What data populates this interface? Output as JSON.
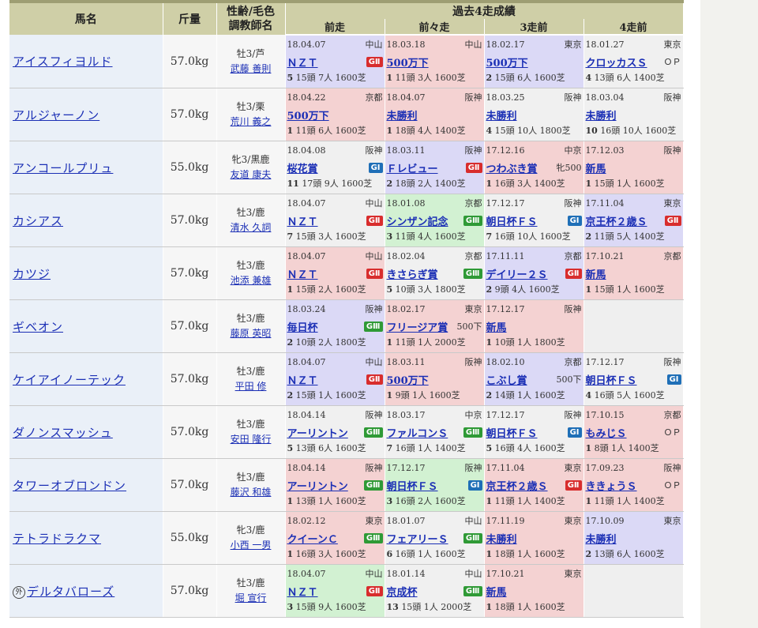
{
  "headers": {
    "name": "馬名",
    "weight": "斤量",
    "sex_line1": "性齢/毛色",
    "sex_line2": "調教師名",
    "past": "過去4走成績",
    "past_cols": [
      "前走",
      "前々走",
      "3走前",
      "4走前"
    ]
  },
  "grade_colors": {
    "GI": "#1f6fb7",
    "GII": "#d82d2d",
    "GIII": "#2f9a36"
  },
  "row_bg_colors": {
    "red": "#f4d2d2",
    "blue": "#dbd9f6",
    "green": "#d2f1d2",
    "gray": "#f0f0f0"
  },
  "horses": [
    {
      "prefix": "",
      "name": "アイスフィヨルド",
      "weight": "57.0kg",
      "sex": "牡3/芦",
      "trainer": "武藤 善則",
      "past": [
        {
          "date": "18.04.07",
          "venue": "中山",
          "race": "ＮＺＴ",
          "grade": "GII",
          "cls": "",
          "result": "5",
          "detail": "15頭 7人 1600芝",
          "bg": "blue"
        },
        {
          "date": "18.03.18",
          "venue": "中山",
          "race": "500万下",
          "grade": "",
          "cls": "",
          "result": "1",
          "detail": "11頭 3人 1600芝",
          "bg": "red"
        },
        {
          "date": "18.02.17",
          "venue": "東京",
          "race": "500万下",
          "grade": "",
          "cls": "",
          "result": "2",
          "detail": "15頭 6人 1600芝",
          "bg": "blue"
        },
        {
          "date": "18.01.27",
          "venue": "東京",
          "race": "クロッカスＳ",
          "grade": "",
          "cls": "ＯＰ",
          "result": "4",
          "detail": "13頭 6人 1400芝",
          "bg": "gray"
        }
      ]
    },
    {
      "prefix": "",
      "name": "アルジャーノン",
      "weight": "57.0kg",
      "sex": "牡3/栗",
      "trainer": "荒川 義之",
      "past": [
        {
          "date": "18.04.22",
          "venue": "京都",
          "race": "500万下",
          "grade": "",
          "cls": "",
          "result": "1",
          "detail": "11頭 6人 1600芝",
          "bg": "red"
        },
        {
          "date": "18.04.07",
          "venue": "阪神",
          "race": "未勝利",
          "grade": "",
          "cls": "",
          "result": "1",
          "detail": "18頭 4人 1400芝",
          "bg": "red"
        },
        {
          "date": "18.03.25",
          "venue": "阪神",
          "race": "未勝利",
          "grade": "",
          "cls": "",
          "result": "4",
          "detail": "15頭 10人 1800芝",
          "bg": "gray"
        },
        {
          "date": "18.03.04",
          "venue": "阪神",
          "race": "未勝利",
          "grade": "",
          "cls": "",
          "result": "10",
          "detail": "16頭 10人 1600芝",
          "bg": "gray"
        }
      ]
    },
    {
      "prefix": "",
      "name": "アンコールプリュ",
      "weight": "55.0kg",
      "sex": "牝3/黒鹿",
      "trainer": "友道 康夫",
      "past": [
        {
          "date": "18.04.08",
          "venue": "阪神",
          "race": "桜花賞",
          "grade": "GI",
          "cls": "",
          "result": "11",
          "detail": "17頭 9人 1600芝",
          "bg": "gray"
        },
        {
          "date": "18.03.11",
          "venue": "阪神",
          "race": "Ｆレビュー",
          "grade": "GII",
          "cls": "",
          "result": "2",
          "detail": "18頭 2人 1400芝",
          "bg": "blue"
        },
        {
          "date": "17.12.16",
          "venue": "中京",
          "race": "つわぶき賞",
          "grade": "",
          "cls": "牝500",
          "result": "1",
          "detail": "16頭 3人 1400芝",
          "bg": "red"
        },
        {
          "date": "17.12.03",
          "venue": "阪神",
          "race": "新馬",
          "grade": "",
          "cls": "",
          "result": "1",
          "detail": "15頭 1人 1600芝",
          "bg": "red"
        }
      ]
    },
    {
      "prefix": "",
      "name": "カシアス",
      "weight": "57.0kg",
      "sex": "牡3/鹿",
      "trainer": "清水 久詞",
      "past": [
        {
          "date": "18.04.07",
          "venue": "中山",
          "race": "ＮＺＴ",
          "grade": "GII",
          "cls": "",
          "result": "7",
          "detail": "15頭 3人 1600芝",
          "bg": "gray"
        },
        {
          "date": "18.01.08",
          "venue": "京都",
          "race": "シンザン記念",
          "grade": "GIII",
          "cls": "",
          "result": "3",
          "detail": "11頭 4人 1600芝",
          "bg": "green"
        },
        {
          "date": "17.12.17",
          "venue": "阪神",
          "race": "朝日杯ＦＳ",
          "grade": "GI",
          "cls": "",
          "result": "7",
          "detail": "16頭 10人 1600芝",
          "bg": "gray"
        },
        {
          "date": "17.11.04",
          "venue": "東京",
          "race": "京王杯２歳Ｓ",
          "grade": "GII",
          "cls": "",
          "result": "2",
          "detail": "11頭 5人 1400芝",
          "bg": "blue"
        }
      ]
    },
    {
      "prefix": "",
      "name": "カツジ",
      "weight": "57.0kg",
      "sex": "牡3/鹿",
      "trainer": "池添 兼雄",
      "past": [
        {
          "date": "18.04.07",
          "venue": "中山",
          "race": "ＮＺＴ",
          "grade": "GII",
          "cls": "",
          "result": "1",
          "detail": "15頭 2人 1600芝",
          "bg": "red"
        },
        {
          "date": "18.02.04",
          "venue": "京都",
          "race": "きさらぎ賞",
          "grade": "GIII",
          "cls": "",
          "result": "5",
          "detail": "10頭 3人 1800芝",
          "bg": "gray"
        },
        {
          "date": "17.11.11",
          "venue": "京都",
          "race": "デイリー２Ｓ",
          "grade": "GII",
          "cls": "",
          "result": "2",
          "detail": "9頭 4人 1600芝",
          "bg": "blue"
        },
        {
          "date": "17.10.21",
          "venue": "京都",
          "race": "新馬",
          "grade": "",
          "cls": "",
          "result": "1",
          "detail": "15頭 1人 1600芝",
          "bg": "red"
        }
      ]
    },
    {
      "prefix": "",
      "name": "ギベオン",
      "weight": "57.0kg",
      "sex": "牡3/鹿",
      "trainer": "藤原 英昭",
      "past": [
        {
          "date": "18.03.24",
          "venue": "阪神",
          "race": "毎日杯",
          "grade": "GIII",
          "cls": "",
          "result": "2",
          "detail": "10頭 2人 1800芝",
          "bg": "blue"
        },
        {
          "date": "18.02.17",
          "venue": "東京",
          "race": "フリージア賞",
          "grade": "",
          "cls": "500下",
          "result": "1",
          "detail": "11頭 1人 2000芝",
          "bg": "red"
        },
        {
          "date": "17.12.17",
          "venue": "阪神",
          "race": "新馬",
          "grade": "",
          "cls": "",
          "result": "1",
          "detail": "10頭 1人 1800芝",
          "bg": "red"
        },
        null
      ]
    },
    {
      "prefix": "",
      "name": "ケイアイノーテック",
      "weight": "57.0kg",
      "sex": "牡3/鹿",
      "trainer": "平田 修",
      "past": [
        {
          "date": "18.04.07",
          "venue": "中山",
          "race": "ＮＺＴ",
          "grade": "GII",
          "cls": "",
          "result": "2",
          "detail": "15頭 1人 1600芝",
          "bg": "blue"
        },
        {
          "date": "18.03.11",
          "venue": "阪神",
          "race": "500万下",
          "grade": "",
          "cls": "",
          "result": "1",
          "detail": "9頭 1人 1600芝",
          "bg": "red"
        },
        {
          "date": "18.02.10",
          "venue": "京都",
          "race": "こぶし賞",
          "grade": "",
          "cls": "500下",
          "result": "2",
          "detail": "14頭 1人 1600芝",
          "bg": "blue"
        },
        {
          "date": "17.12.17",
          "venue": "阪神",
          "race": "朝日杯ＦＳ",
          "grade": "GI",
          "cls": "",
          "result": "4",
          "detail": "16頭 5人 1600芝",
          "bg": "gray"
        }
      ]
    },
    {
      "prefix": "",
      "name": "ダノンスマッシュ",
      "weight": "57.0kg",
      "sex": "牡3/鹿",
      "trainer": "安田 隆行",
      "past": [
        {
          "date": "18.04.14",
          "venue": "阪神",
          "race": "アーリントン",
          "grade": "GIII",
          "cls": "",
          "result": "5",
          "detail": "13頭 6人 1600芝",
          "bg": "gray"
        },
        {
          "date": "18.03.17",
          "venue": "中京",
          "race": "ファルコンＳ",
          "grade": "GIII",
          "cls": "",
          "result": "7",
          "detail": "16頭 1人 1400芝",
          "bg": "gray"
        },
        {
          "date": "17.12.17",
          "venue": "阪神",
          "race": "朝日杯ＦＳ",
          "grade": "GI",
          "cls": "",
          "result": "5",
          "detail": "16頭 4人 1600芝",
          "bg": "gray"
        },
        {
          "date": "17.10.15",
          "venue": "京都",
          "race": "もみじＳ",
          "grade": "",
          "cls": "ＯＰ",
          "result": "1",
          "detail": "8頭 1人 1400芝",
          "bg": "red"
        }
      ]
    },
    {
      "prefix": "",
      "name": "タワーオブロンドン",
      "weight": "57.0kg",
      "sex": "牡3/鹿",
      "trainer": "藤沢 和雄",
      "past": [
        {
          "date": "18.04.14",
          "venue": "阪神",
          "race": "アーリントン",
          "grade": "GIII",
          "cls": "",
          "result": "1",
          "detail": "13頭 1人 1600芝",
          "bg": "red"
        },
        {
          "date": "17.12.17",
          "venue": "阪神",
          "race": "朝日杯ＦＳ",
          "grade": "GI",
          "cls": "",
          "result": "3",
          "detail": "16頭 2人 1600芝",
          "bg": "green"
        },
        {
          "date": "17.11.04",
          "venue": "東京",
          "race": "京王杯２歳Ｓ",
          "grade": "GII",
          "cls": "",
          "result": "1",
          "detail": "11頭 1人 1400芝",
          "bg": "red"
        },
        {
          "date": "17.09.23",
          "venue": "阪神",
          "race": "ききょうＳ",
          "grade": "",
          "cls": "ＯＰ",
          "result": "1",
          "detail": "11頭 1人 1400芝",
          "bg": "red"
        }
      ]
    },
    {
      "prefix": "",
      "name": "テトラドラクマ",
      "weight": "55.0kg",
      "sex": "牝3/鹿",
      "trainer": "小西 一男",
      "past": [
        {
          "date": "18.02.12",
          "venue": "東京",
          "race": "クイーンＣ",
          "grade": "GIII",
          "cls": "",
          "result": "1",
          "detail": "16頭 3人 1600芝",
          "bg": "red"
        },
        {
          "date": "18.01.07",
          "venue": "中山",
          "race": "フェアリーＳ",
          "grade": "GIII",
          "cls": "",
          "result": "6",
          "detail": "16頭 1人 1600芝",
          "bg": "gray"
        },
        {
          "date": "17.11.19",
          "venue": "東京",
          "race": "未勝利",
          "grade": "",
          "cls": "",
          "result": "1",
          "detail": "18頭 1人 1600芝",
          "bg": "red"
        },
        {
          "date": "17.10.09",
          "venue": "東京",
          "race": "未勝利",
          "grade": "",
          "cls": "",
          "result": "2",
          "detail": "13頭 6人 1600芝",
          "bg": "blue"
        }
      ]
    },
    {
      "prefix": "外",
      "name": "デルタバローズ",
      "weight": "57.0kg",
      "sex": "牡3/鹿",
      "trainer": "堀 宣行",
      "past": [
        {
          "date": "18.04.07",
          "venue": "中山",
          "race": "ＮＺＴ",
          "grade": "GII",
          "cls": "",
          "result": "3",
          "detail": "15頭 9人 1600芝",
          "bg": "green"
        },
        {
          "date": "18.01.14",
          "venue": "中山",
          "race": "京成杯",
          "grade": "GIII",
          "cls": "",
          "result": "13",
          "detail": "15頭 1人 2000芝",
          "bg": "gray"
        },
        {
          "date": "17.10.21",
          "venue": "東京",
          "race": "新馬",
          "grade": "",
          "cls": "",
          "result": "1",
          "detail": "18頭 1人 1600芝",
          "bg": "red"
        },
        null
      ]
    }
  ]
}
